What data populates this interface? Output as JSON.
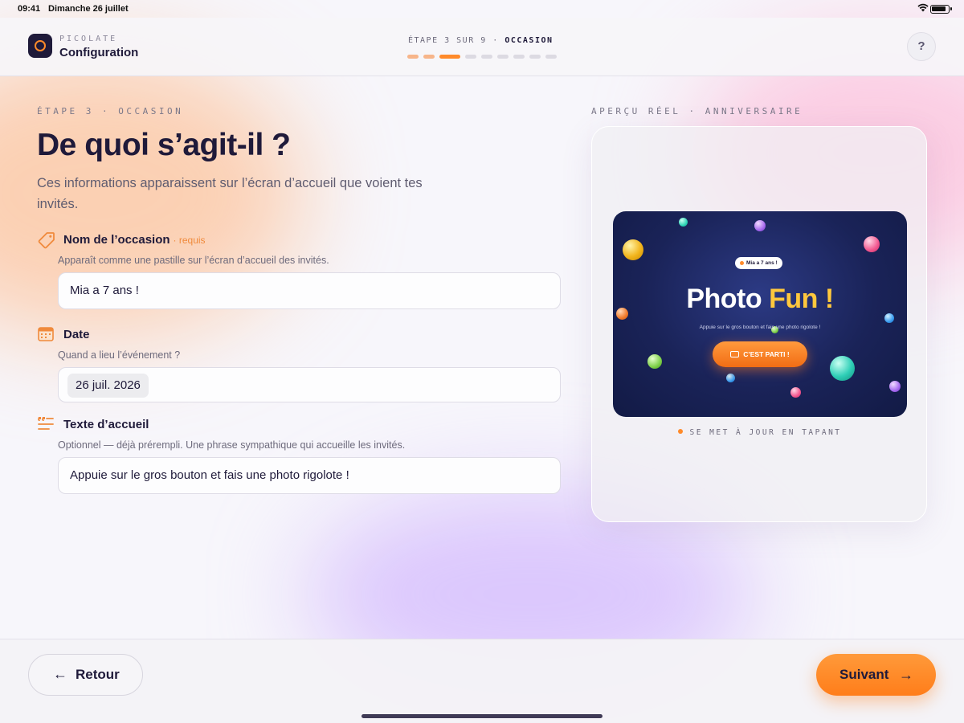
{
  "status_bar": {
    "time": "09:41",
    "date": "Dimanche 26 juillet"
  },
  "header": {
    "brand": "PICOLATE",
    "title": "Configuration",
    "step_prefix": "ÉTAPE 3 SUR 9 ·",
    "step_name": "OCCASION",
    "help_label": "?",
    "progress": {
      "current_step": 3,
      "total_steps": 9
    }
  },
  "main": {
    "eyebrow": "ÉTAPE 3 · OCCASION",
    "title": "De quoi s’agit-il ?",
    "subtitle": "Ces informations apparaissent sur l’écran d’accueil que voient tes invités.",
    "fields": {
      "occasion": {
        "label": "Nom de l’occasion",
        "required_label": "· requis",
        "help": "Apparaît comme une pastille sur l’écran d’accueil des invités.",
        "value": "Mia a 7 ans !",
        "icon": "tag-icon"
      },
      "date": {
        "label": "Date",
        "help": "Quand a lieu l’événement ?",
        "value": "26 juil. 2026",
        "icon": "calendar-icon"
      },
      "welcome": {
        "label": "Texte d’accueil",
        "help": "Optionnel — déjà prérempli. Une phrase sympathique qui accueille les invités.",
        "value": "Appuie sur le gros bouton et fais une photo rigolote !",
        "icon": "quote-icon"
      }
    }
  },
  "preview": {
    "eyebrow": "APERÇU RÉEL · ANNIVERSAIRE",
    "pill": "Mia a 7 ans !",
    "title_main": "Photo",
    "title_accent": "Fun !",
    "subtitle": "Appuie sur le gros bouton et fais une photo rigolote !",
    "button": "C’EST PARTI !",
    "live_note": "SE MET À JOUR EN TAPANT"
  },
  "footer": {
    "back_label": "Retour",
    "next_label": "Suivant"
  },
  "colors": {
    "accent": "#ff8a2a",
    "ink": "#1f1a3a",
    "preview_bg": "#1a2358",
    "title_accent": "#ffc83d"
  }
}
